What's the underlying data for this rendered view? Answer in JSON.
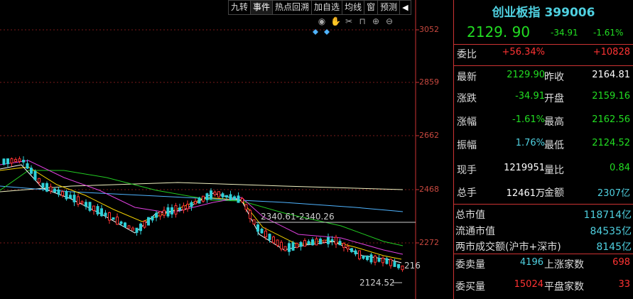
{
  "toolbar": {
    "buttons": [
      "九转",
      "事件",
      "热点回溯",
      "加自选",
      "均线",
      "窗",
      "预测"
    ],
    "arrow": "◀"
  },
  "tools": [
    "eye-icon",
    "hand-icon",
    "scissors-icon",
    "lock-icon",
    "zoom-in-icon",
    "zoom-out-icon"
  ],
  "chart": {
    "y_labels": [
      "3052",
      "2859",
      "2662",
      "2468",
      "2272"
    ],
    "range_annotation": "2340.61-2340.26",
    "low_marker": "2124.52",
    "right_marker": "216",
    "colors": {
      "up": "#ff3333",
      "down": "#2fd0d8",
      "ma5": "#ffffff",
      "ma10": "#f5d300",
      "ma20": "#e040e0",
      "ma30": "#22cc22",
      "ma60": "#4fb4ff",
      "ma120": "#f0f0c0"
    }
  },
  "chart_data": {
    "type": "candlestick",
    "ylim": [
      2100,
      3100
    ],
    "y_ticks": [
      3052,
      2859,
      2662,
      2468,
      2272
    ],
    "annotations": [
      "2340.61-2340.26",
      "2124.52"
    ]
  },
  "panel": {
    "title": "创业板指 399006",
    "price": "2129. 90",
    "change": "-34.91",
    "change_pct": "-1.61%",
    "weibi": {
      "label": "委比",
      "pct": "+56.34%",
      "diff": "+10828"
    },
    "rows": [
      {
        "l1": "最新",
        "v1": "2129.90",
        "c1": "green",
        "l2": "昨收",
        "v2": "2164.81",
        "c2": "white"
      },
      {
        "l1": "涨跌",
        "v1": "-34.91",
        "c1": "green",
        "l2": "开盘",
        "v2": "2159.16",
        "c2": "green"
      },
      {
        "l1": "涨幅",
        "v1": "-1.61%",
        "c1": "green",
        "l2": "最高",
        "v2": "2162.56",
        "c2": "green"
      },
      {
        "l1": "振幅",
        "v1": "1.76%",
        "c1": "cyan",
        "l2": "最低",
        "v2": "2124.52",
        "c2": "green"
      },
      {
        "l1": "现手",
        "v1": "1219951",
        "c1": "white",
        "l2": "量比",
        "v2": "0.84",
        "c2": "green"
      },
      {
        "l1": "总手",
        "v1": "12461万",
        "c1": "white",
        "l2": "金额",
        "v2": "2307亿",
        "c2": "cyan"
      }
    ],
    "market": [
      {
        "label": "总市值",
        "value": "118714亿"
      },
      {
        "label": "流通市值",
        "value": "84535亿"
      },
      {
        "label": "两市成交额(沪市+深市)",
        "value": "8145亿"
      }
    ],
    "bottom": [
      {
        "l1": "委卖量",
        "v1": "4196",
        "l2": "上涨家数",
        "v2": "698"
      },
      {
        "l1": "委买量",
        "v1": "15024",
        "l2": "平盘家数",
        "v2": "33"
      }
    ]
  }
}
